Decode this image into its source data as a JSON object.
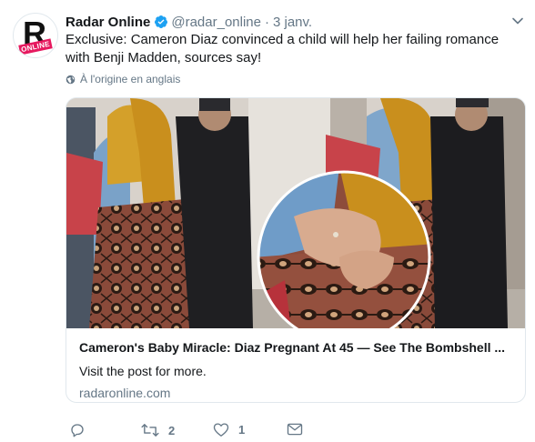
{
  "tweet": {
    "display_name": "Radar Online",
    "handle": "@radar_online",
    "separator": "·",
    "date": "3 janv.",
    "text": "Exclusive: Cameron Diaz convinced a child will help her failing romance with Benji Madden, sources say!",
    "translate_label": "À l'origine en anglais"
  },
  "avatar": {
    "letter": "R",
    "tag": "ONLINE"
  },
  "card": {
    "title": "Cameron's Baby Miracle: Diaz Pregnant At 45 — See The Bombshell ...",
    "description": "Visit the post for more.",
    "domain": "radaronline.com"
  },
  "actions": {
    "reply_count": "",
    "retweet_count": "2",
    "like_count": "1"
  },
  "colors": {
    "verified": "#1da1f2",
    "muted": "#657786",
    "text": "#14171a",
    "brand_pink": "#e6195f"
  },
  "icons": [
    "verified-badge-icon",
    "chevron-down-icon",
    "globe-icon",
    "reply-icon",
    "retweet-icon",
    "like-icon",
    "message-icon"
  ]
}
